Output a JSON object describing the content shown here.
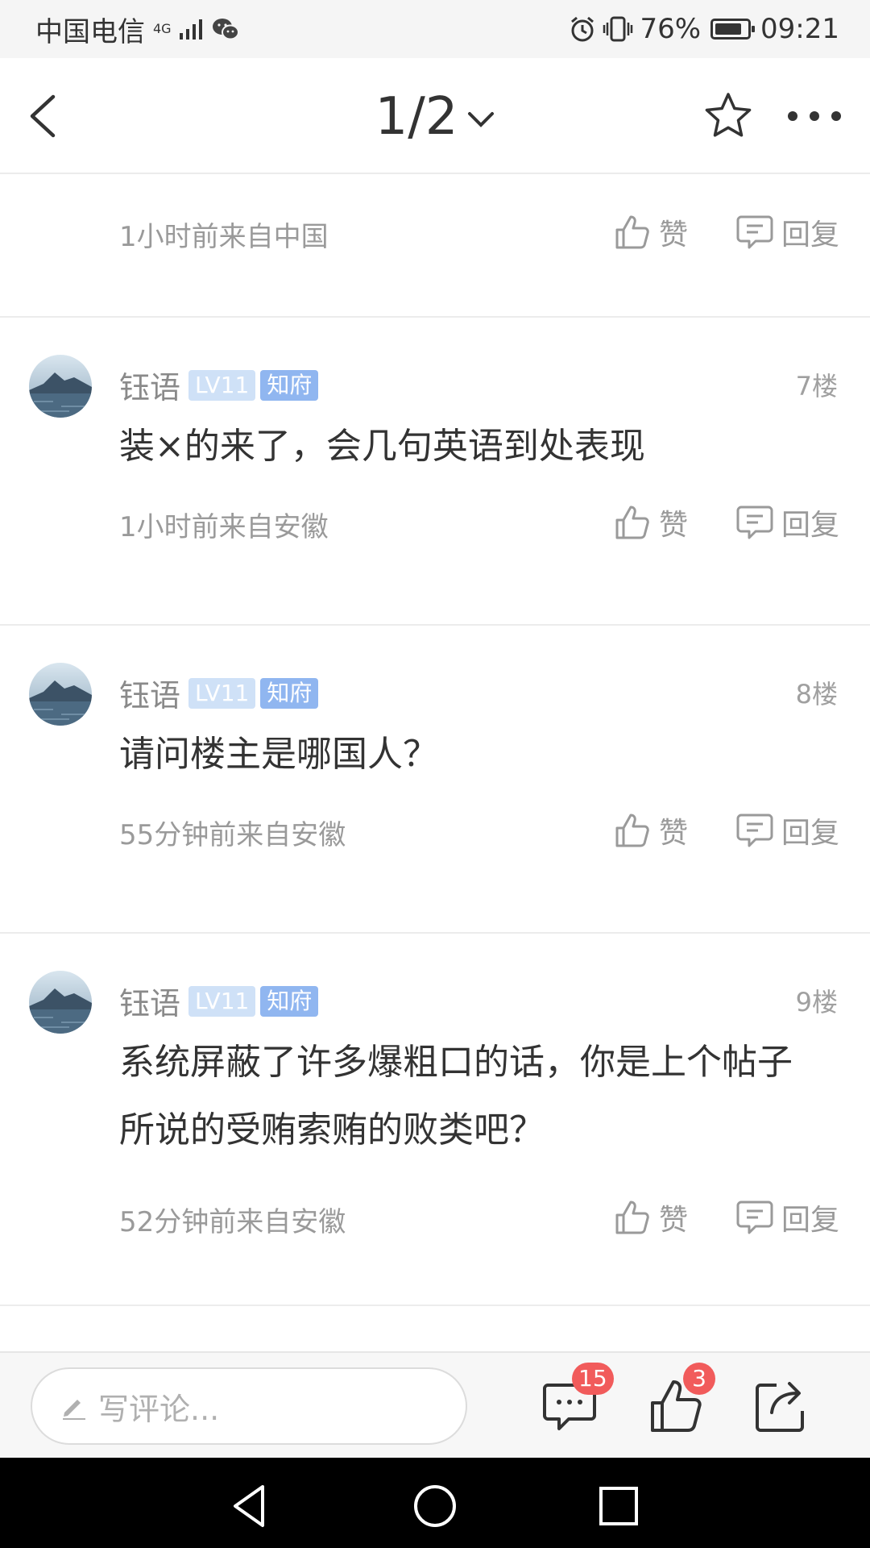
{
  "status_bar": {
    "carrier": "中国电信",
    "network": "4G",
    "battery": "76%",
    "battery_level": 0.76,
    "time": "09:21"
  },
  "header": {
    "page_indicator": "1/2"
  },
  "comments": [
    {
      "meta": "1小时前来自中国",
      "like_label": "赞",
      "reply_label": "回复"
    },
    {
      "username": "钰语",
      "level": "LV11",
      "rank": "知府",
      "floor": "7楼",
      "content": "装×的来了，会几句英语到处表现",
      "meta": "1小时前来自安徽",
      "like_label": "赞",
      "reply_label": "回复"
    },
    {
      "username": "钰语",
      "level": "LV11",
      "rank": "知府",
      "floor": "8楼",
      "content": "请问楼主是哪国人？",
      "meta": "55分钟前来自安徽",
      "like_label": "赞",
      "reply_label": "回复"
    },
    {
      "username": "钰语",
      "level": "LV11",
      "rank": "知府",
      "floor": "9楼",
      "content": "系统屏蔽了许多爆粗口的话，你是上个帖子所说的受贿索贿的败类吧？",
      "meta": "52分钟前来自安徽",
      "like_label": "赞",
      "reply_label": "回复"
    }
  ],
  "bottom_bar": {
    "input_placeholder": "写评论...",
    "comment_count": "15",
    "like_count": "3"
  },
  "icons": {
    "back": "back-arrow-icon",
    "dropdown": "chevron-down-icon",
    "favorite": "star-icon",
    "more": "more-dots-icon",
    "like": "thumb-up-icon",
    "reply": "comment-bubble-icon",
    "edit": "pencil-icon",
    "share": "share-icon"
  },
  "colors": {
    "badge_level": "#cfe1f7",
    "badge_rank": "#90b6f0",
    "count_badge": "#f15b5b"
  }
}
